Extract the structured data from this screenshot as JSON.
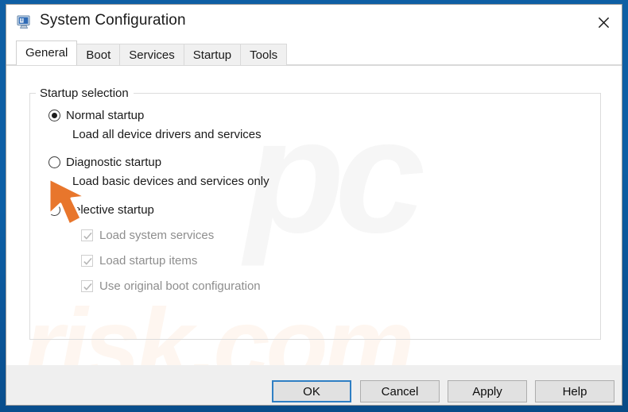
{
  "window": {
    "title": "System Configuration",
    "icon": "computer-monitor-icon",
    "close_label": "✕"
  },
  "tabs": [
    {
      "label": "General",
      "active": true
    },
    {
      "label": "Boot",
      "active": false
    },
    {
      "label": "Services",
      "active": false
    },
    {
      "label": "Startup",
      "active": false
    },
    {
      "label": "Tools",
      "active": false
    }
  ],
  "group": {
    "legend": "Startup selection"
  },
  "radios": [
    {
      "label": "Normal startup",
      "checked": true,
      "description": "Load all device drivers and services"
    },
    {
      "label": "Diagnostic startup",
      "checked": false,
      "description": "Load basic devices and services only"
    },
    {
      "label": "Selective startup",
      "checked": false,
      "description": ""
    }
  ],
  "checkboxes": [
    {
      "label": "Load system services",
      "checked": true,
      "enabled": false
    },
    {
      "label": "Load startup items",
      "checked": true,
      "enabled": false
    },
    {
      "label": "Use original boot configuration",
      "checked": true,
      "enabled": false
    }
  ],
  "buttons": [
    {
      "label": "OK",
      "default": true
    },
    {
      "label": "Cancel",
      "default": false
    },
    {
      "label": "Apply",
      "default": false
    },
    {
      "label": "Help",
      "default": false
    }
  ],
  "watermarks": {
    "logo": "pc",
    "domain": "risk.com"
  },
  "colors": {
    "frame_blue": "#0d5fa5",
    "dialog_bg": "#efefef",
    "content_bg": "#ffffff",
    "focus_blue": "#2f7fc4",
    "disabled_text": "#8e8e8e",
    "cursor_orange": "#e8762c"
  }
}
